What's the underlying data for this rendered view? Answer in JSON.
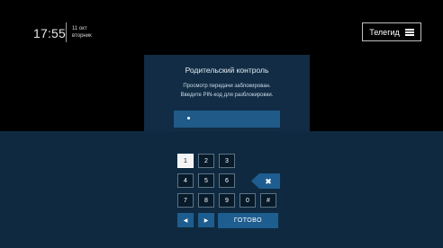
{
  "clock": {
    "time": "17:55",
    "date_line1": "11 окт",
    "date_line2": "вторник"
  },
  "header": {
    "tvguide_label": "Телегид"
  },
  "dialog": {
    "title": "Родительский контроль",
    "message_line1": "Просмотр передачи заблокирован.",
    "message_line2": "Введите PIN-код для разблокировки.",
    "pin_mask": "•"
  },
  "keypad": {
    "keys": [
      "1",
      "2",
      "3",
      "4",
      "5",
      "6",
      "7",
      "8",
      "9",
      "0",
      "#"
    ],
    "left_arrow": "◀",
    "right_arrow": "▶",
    "done_label": "ГОТОВО",
    "backspace_symbol": "✖"
  },
  "colors": {
    "accent": "#1e5d90",
    "panel": "#0f2a40",
    "dialog": "#112c44"
  }
}
